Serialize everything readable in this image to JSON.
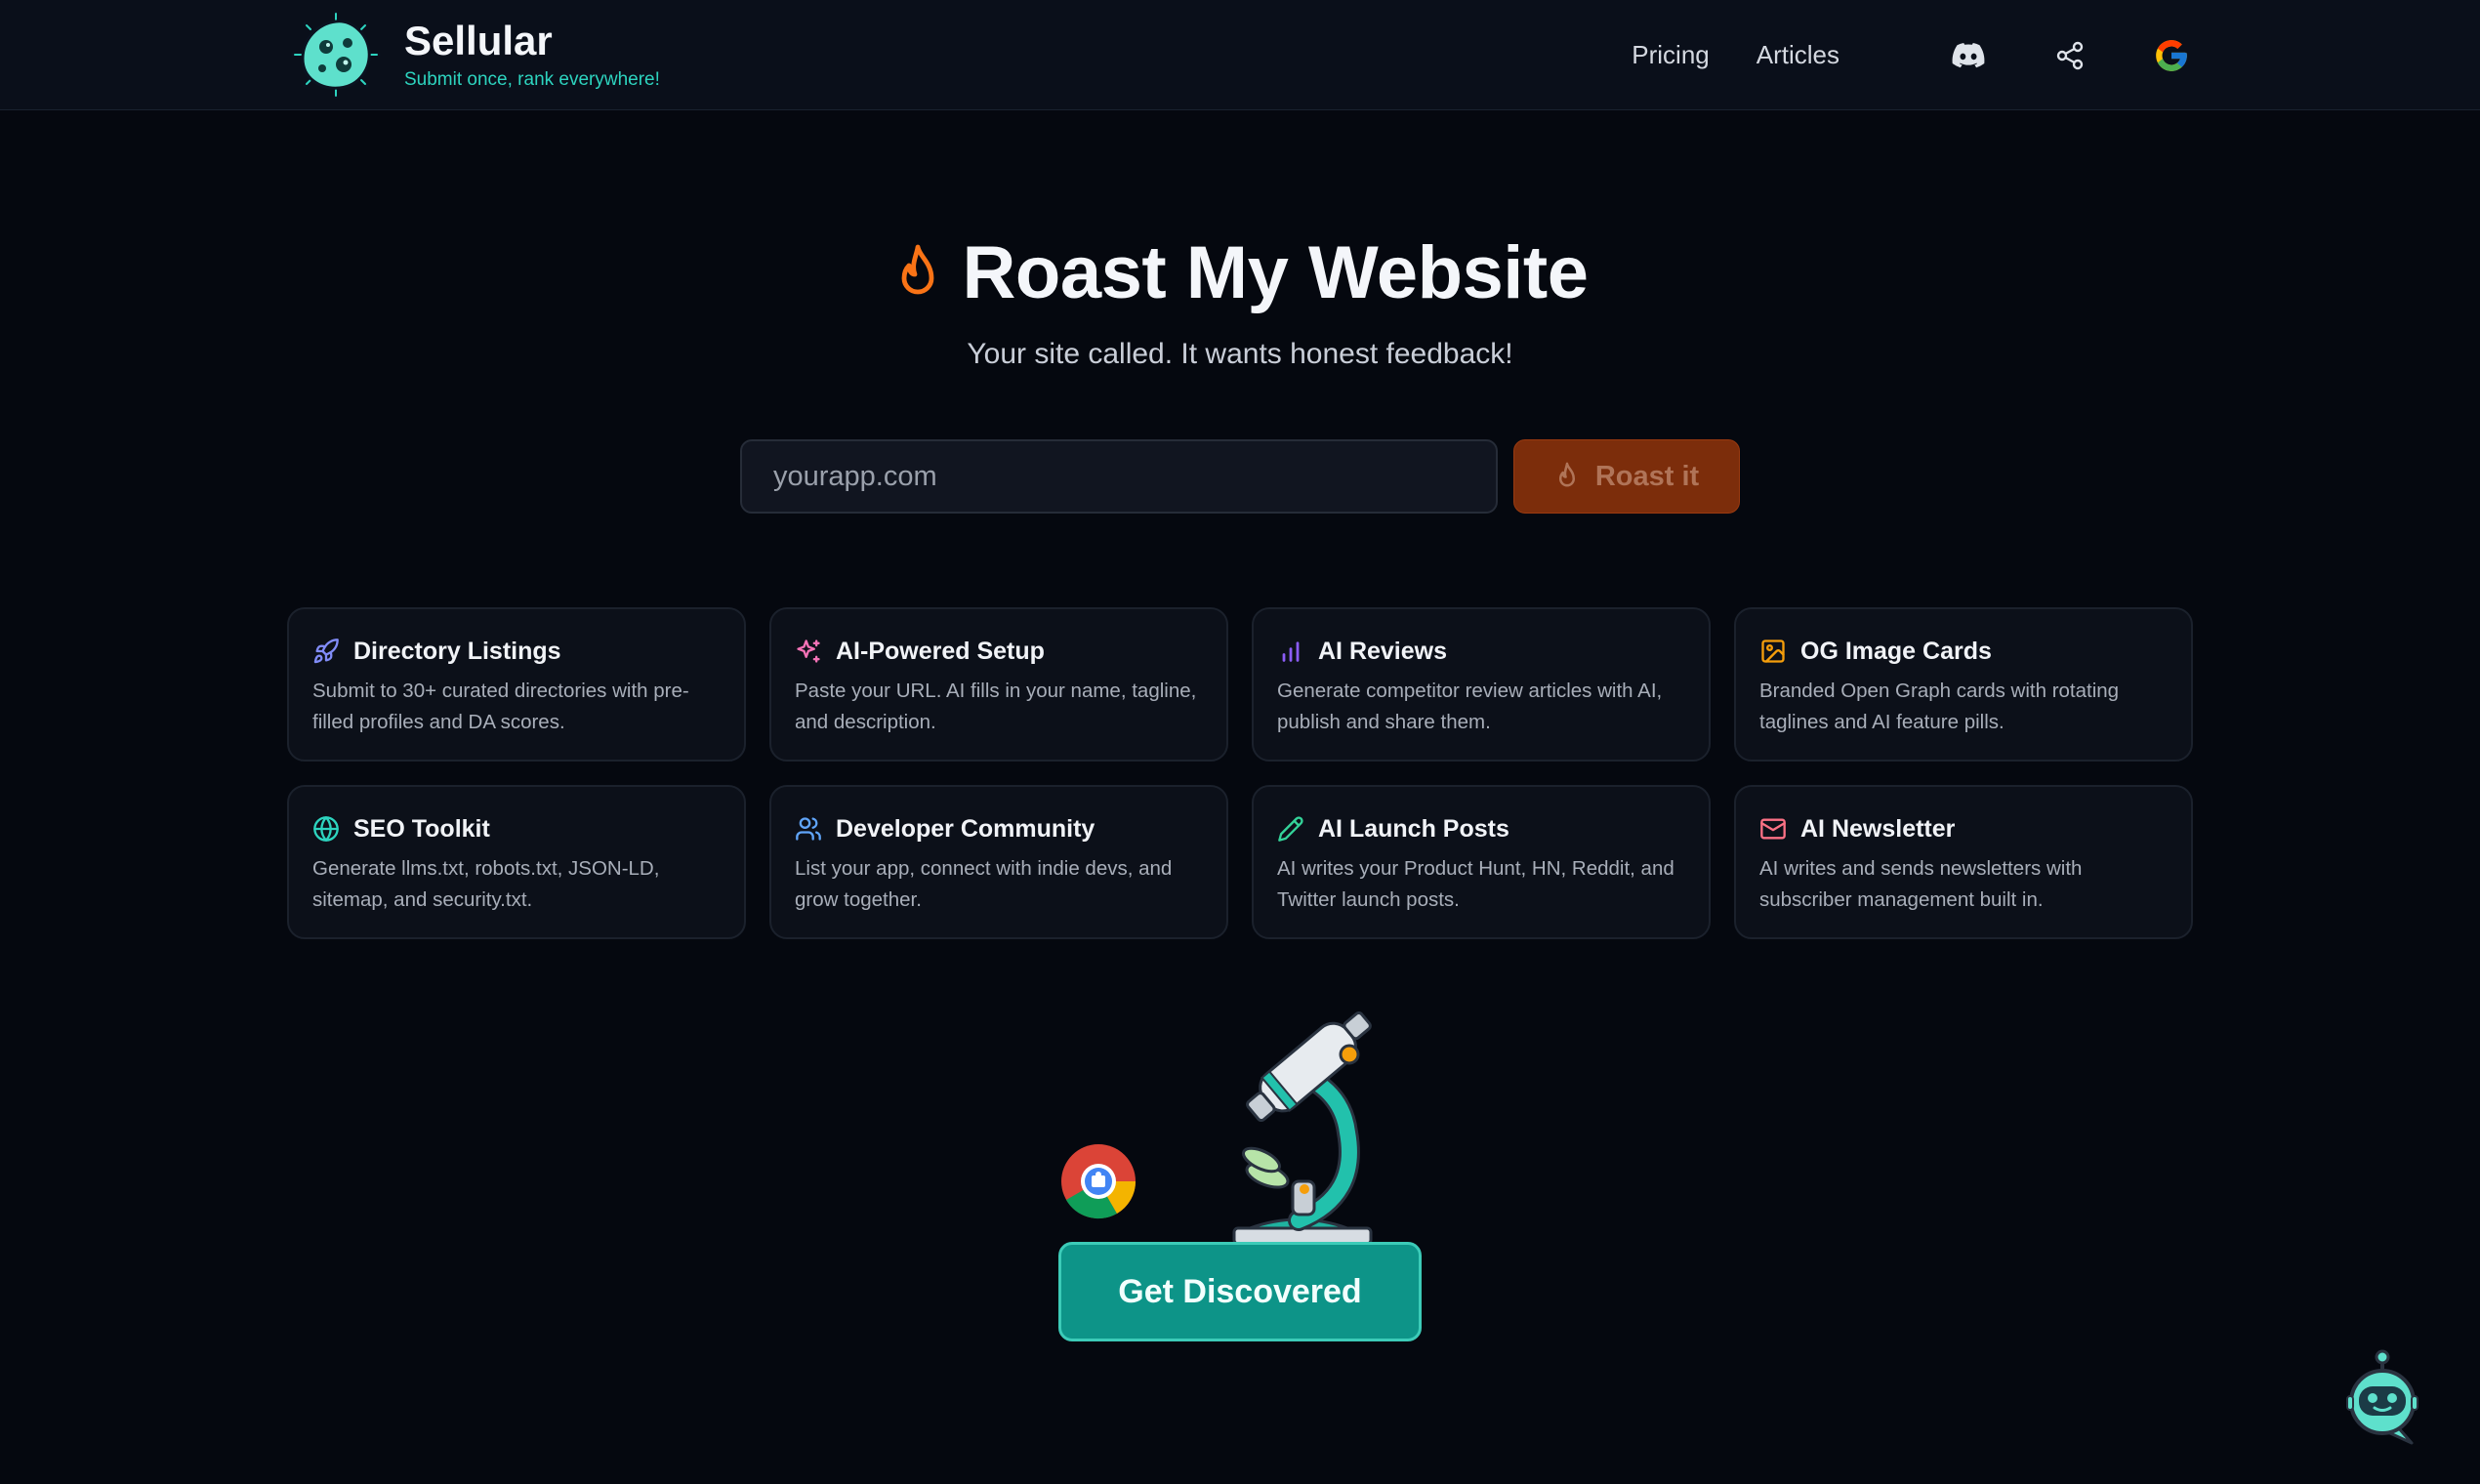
{
  "header": {
    "brand_name": "Sellular",
    "tagline": "Submit once, rank everywhere!",
    "nav": {
      "pricing": "Pricing",
      "articles": "Articles"
    },
    "icons": [
      "discord-icon",
      "share-icon",
      "google-icon"
    ]
  },
  "hero": {
    "title": "Roast My Website",
    "subtitle": "Your site called. It wants honest feedback!",
    "input_placeholder": "yourapp.com",
    "button_label": "Roast it"
  },
  "features": [
    {
      "icon": "rocket-icon",
      "title": "Directory Listings",
      "desc": "Submit to 30+ curated directories with pre-filled profiles and DA scores.",
      "color": "#818cf8"
    },
    {
      "icon": "sparkles-icon",
      "title": "AI-Powered Setup",
      "desc": "Paste your URL. AI fills in your name, tagline, and description.",
      "color": "#f472b6"
    },
    {
      "icon": "bar-chart-icon",
      "title": "AI Reviews",
      "desc": "Generate competitor review articles with AI, publish and share them.",
      "color": "#8b5cf6"
    },
    {
      "icon": "image-icon",
      "title": "OG Image Cards",
      "desc": "Branded Open Graph cards with rotating taglines and AI feature pills.",
      "color": "#f59e0b"
    },
    {
      "icon": "globe-icon",
      "title": "SEO Toolkit",
      "desc": "Generate llms.txt, robots.txt, JSON-LD, sitemap, and security.txt.",
      "color": "#2dd4bf"
    },
    {
      "icon": "users-icon",
      "title": "Developer Community",
      "desc": "List your app, connect with indie devs, and grow together.",
      "color": "#60a5fa"
    },
    {
      "icon": "pencil-icon",
      "title": "AI Launch Posts",
      "desc": "AI writes your Product Hunt, HN, Reddit, and Twitter launch posts.",
      "color": "#34d399"
    },
    {
      "icon": "mail-icon",
      "title": "AI Newsletter",
      "desc": "AI writes and sends newsletters with subscriber management built in.",
      "color": "#fb7185"
    }
  ],
  "cta": {
    "label": "Get Discovered"
  },
  "colors": {
    "accent": "#0d9488",
    "flame": "#f97316",
    "background": "#05080f"
  }
}
